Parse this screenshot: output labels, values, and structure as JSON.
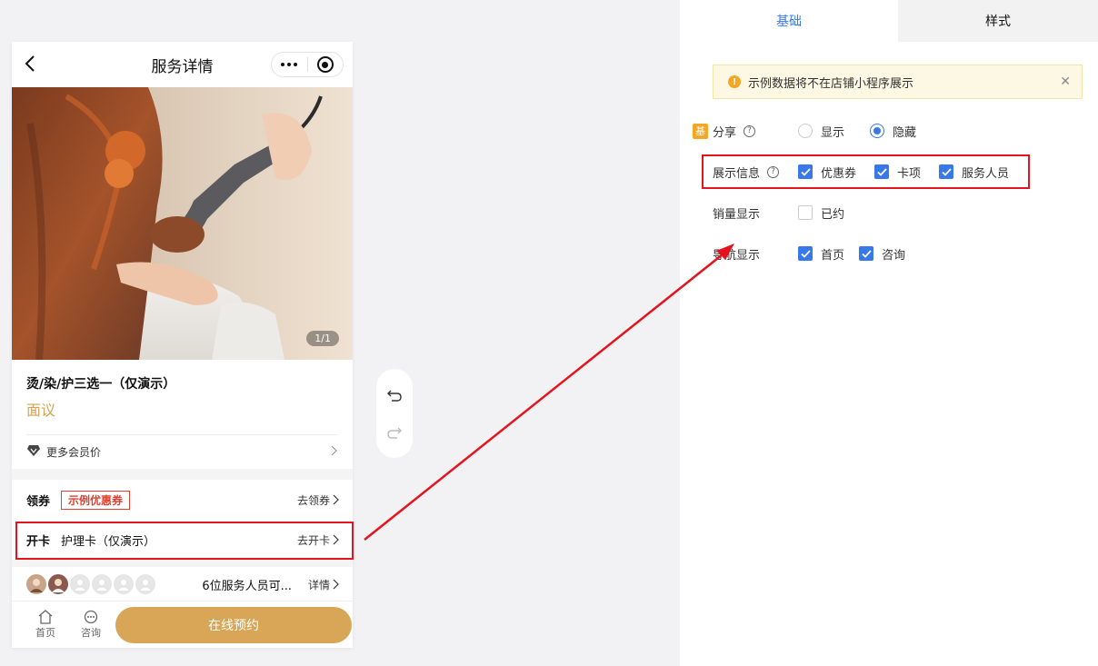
{
  "phone": {
    "title": "服务详情",
    "image_indicator": "1/1",
    "service_name": "烫/染/护三选一（仅演示）",
    "price": "面议",
    "member_price": "更多会员价",
    "coupon": {
      "key": "领券",
      "tag": "示例优惠券",
      "action": "去领券"
    },
    "card": {
      "key": "开卡",
      "desc": "护理卡（仅演示）",
      "action": "去开卡"
    },
    "staff": {
      "text": "6位服务人员可...",
      "action": "详情"
    },
    "tabbar": {
      "home": "首页",
      "consult": "咨询",
      "book": "在线预约"
    }
  },
  "settings": {
    "tabs": [
      {
        "label": "基础",
        "active": true
      },
      {
        "label": "样式",
        "active": false
      }
    ],
    "notice": "示例数据将不在店铺小程序展示",
    "share": {
      "badge": "基",
      "label": "分享",
      "help": "?",
      "options": [
        "显示",
        "隐藏"
      ],
      "selected": "隐藏"
    },
    "display_info": {
      "label": "展示信息",
      "help": "?",
      "options": [
        {
          "label": "优惠券",
          "checked": true
        },
        {
          "label": "卡项",
          "checked": true
        },
        {
          "label": "服务人员",
          "checked": true
        }
      ]
    },
    "sales_display": {
      "label": "销量显示",
      "options": [
        {
          "label": "已约",
          "checked": false
        }
      ]
    },
    "nav_display": {
      "label": "导航显示",
      "options": [
        {
          "label": "首页",
          "checked": true
        },
        {
          "label": "咨询",
          "checked": true
        }
      ]
    }
  },
  "colors": {
    "accent": "#3878e8",
    "gold": "#d8a656",
    "highlight": "#e3141d"
  }
}
